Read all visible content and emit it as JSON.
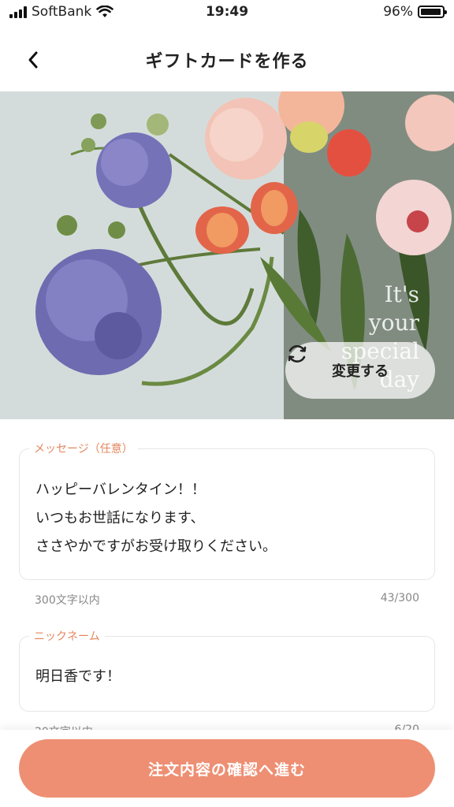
{
  "status_bar": {
    "carrier": "SoftBank",
    "time": "19:49",
    "battery": "96%",
    "battery_level": 0.96
  },
  "header": {
    "title": "ギフトカードを作る"
  },
  "card": {
    "script_lines": [
      "It's",
      "your",
      "special",
      "day"
    ],
    "change_label": "変更する"
  },
  "message": {
    "legend": "メッセージ（任意）",
    "lines": [
      "ハッピーバレンタイン！！",
      "いつもお世話になります、",
      "ささやかですがお受け取りください。"
    ],
    "hint": "300文字以内",
    "count": "43/300"
  },
  "nickname": {
    "legend": "ニックネーム",
    "value": "明日香です！",
    "hint": "20文字以内",
    "count": "6/20"
  },
  "footer": {
    "cta_label": "注文内容の確認へ進む"
  },
  "colors": {
    "accent": "#ee8f73",
    "legend": "#e4875f"
  }
}
